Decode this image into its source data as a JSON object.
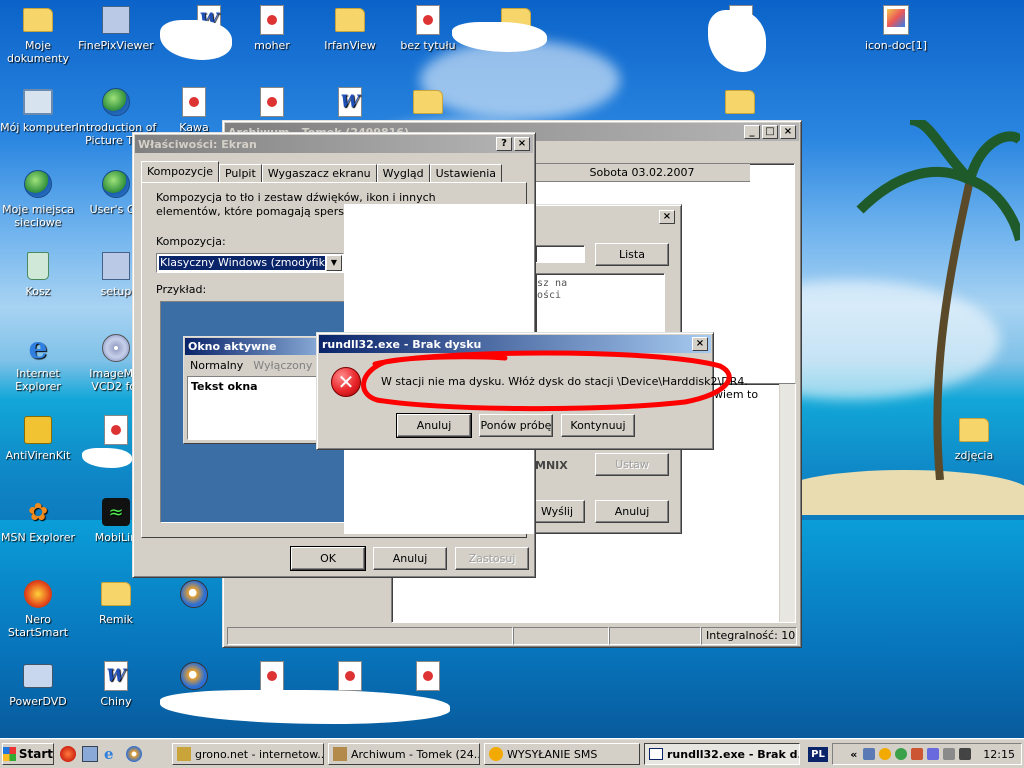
{
  "desktop": {
    "icons": [
      {
        "label": "Moje dokumenty",
        "icon": "folder-documents-icon"
      },
      {
        "label": "FinePixViewer",
        "icon": "finepix-icon"
      },
      {
        "label": "moher",
        "icon": "document-icon"
      },
      {
        "label": "IrfanView",
        "icon": "folder-icon"
      },
      {
        "label": "bez tytułu",
        "icon": "document-icon"
      },
      {
        "label": "Mój komputer",
        "icon": "computer-icon"
      },
      {
        "label": "Introduction of Picture The",
        "icon": "ie-shortcut-icon"
      },
      {
        "label": "Kawa",
        "icon": "document-icon"
      },
      {
        "label": "Moje miejsca sieciowe",
        "icon": "network-icon"
      },
      {
        "label": "User's Gu",
        "icon": "ie-shortcut-icon"
      },
      {
        "label": "Kosz",
        "icon": "recycle-bin-icon"
      },
      {
        "label": "setup",
        "icon": "setup-icon"
      },
      {
        "label": "Internet Explorer",
        "icon": "internet-explorer-icon"
      },
      {
        "label": "ImageMix VCD2 for",
        "icon": "disc-icon"
      },
      {
        "label": "AntiVirenKit",
        "icon": "antivirus-icon"
      },
      {
        "label": "MSN Explorer",
        "icon": "msn-butterfly-icon"
      },
      {
        "label": "MobiLin",
        "icon": "mobilink-icon"
      },
      {
        "label": "Nero StartSmart",
        "icon": "nero-icon"
      },
      {
        "label": "Remik",
        "icon": "folder-icon"
      },
      {
        "label": "PowerDVD",
        "icon": "dvd-icon"
      },
      {
        "label": "Chiny",
        "icon": "word-icon"
      },
      {
        "label": "icon-doc[1]",
        "icon": "image-document-icon"
      },
      {
        "label": "zdjęcia",
        "icon": "folder-icon"
      }
    ]
  },
  "archive_window": {
    "title": "Archiwum - Tomek (2499816)",
    "date": "Sobota 03.02.2007",
    "status_text": "Integralność: 10",
    "text_fragment": "wiem to"
  },
  "inner_dialog": {
    "list_button": "Lista",
    "text1": "sz na",
    "text2": "ości",
    "label_mnix": "MNIX",
    "set_button": "Ustaw",
    "send_button": "Wyślij",
    "cancel_button": "Anuluj"
  },
  "display_properties": {
    "title": "Właściwości: Ekran",
    "tabs": [
      "Kompozycje",
      "Pulpit",
      "Wygaszacz ekranu",
      "Wygląd",
      "Ustawienia"
    ],
    "description": "Kompozycja to tło i zestaw dźwięków, ikon i innych elementów, które pomagają spersonalizować komputer za",
    "theme_label": "Kompozycja:",
    "theme_value": "Klasyczny Windows (zmodyfikowany)",
    "preview_label": "Przykład:",
    "preview_window_title": "Okno aktywne",
    "preview_menu": [
      "Normalny",
      "Wyłączony",
      "W"
    ],
    "preview_text": "Tekst okna",
    "ok": "OK",
    "cancel": "Anuluj",
    "apply": "Zastosuj"
  },
  "error_dialog": {
    "title": "rundll32.exe - Brak dysku",
    "message": "W stacji nie ma dysku. Włóż dysk do stacji \\Device\\Harddisk2\\DR4.",
    "cancel": "Anuluj",
    "retry": "Ponów próbę",
    "continue": "Kontynuuj"
  },
  "taskbar": {
    "start": "Start",
    "tasks": [
      {
        "label": "grono.net - internetow...",
        "active": false
      },
      {
        "label": "Archiwum - Tomek (24...",
        "active": false
      },
      {
        "label": "WYSYŁANIE SMS",
        "active": false
      },
      {
        "label": "rundll32.exe - Brak d...",
        "active": true
      }
    ],
    "language": "PL",
    "clock": "12:15"
  },
  "colors": {
    "title_active": "#0a246a",
    "title_inactive": "#808080",
    "error_circle": "#e8262b",
    "highlight_scribble": "#ff0000"
  }
}
